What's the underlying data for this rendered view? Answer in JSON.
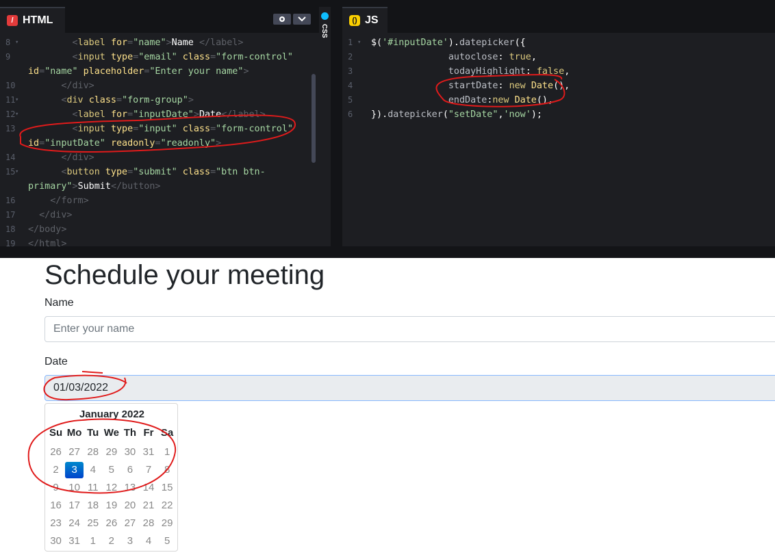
{
  "editor": {
    "html_tab": "HTML",
    "js_tab": "JS",
    "css_tab": "CSS",
    "html_lines": [
      {
        "n": "8",
        "arrow": true
      },
      {
        "n": "9",
        "arrow": false
      },
      {
        "n": "",
        "arrow": false
      },
      {
        "n": "10",
        "arrow": false
      },
      {
        "n": "11",
        "arrow": true
      },
      {
        "n": "12",
        "arrow": true
      },
      {
        "n": "13",
        "arrow": false
      },
      {
        "n": "",
        "arrow": false
      },
      {
        "n": "14",
        "arrow": false
      },
      {
        "n": "15",
        "arrow": true
      },
      {
        "n": "",
        "arrow": false
      },
      {
        "n": "16",
        "arrow": false
      },
      {
        "n": "17",
        "arrow": false
      },
      {
        "n": "18",
        "arrow": false
      },
      {
        "n": "19",
        "arrow": false
      }
    ],
    "js_lines": [
      "1",
      "2",
      "3",
      "4",
      "5",
      "6"
    ]
  },
  "page": {
    "heading": "Schedule your meeting",
    "name_label": "Name",
    "name_placeholder": "Enter your name",
    "date_label": "Date",
    "date_value": "01/03/2022"
  },
  "datepicker": {
    "title": "January 2022",
    "days": [
      "Su",
      "Mo",
      "Tu",
      "We",
      "Th",
      "Fr",
      "Sa"
    ],
    "weeks": [
      [
        [
          "26",
          1
        ],
        [
          "27",
          1
        ],
        [
          "28",
          1
        ],
        [
          "29",
          1
        ],
        [
          "30",
          1
        ],
        [
          "31",
          1
        ],
        [
          "1",
          1
        ]
      ],
      [
        [
          "2",
          1
        ],
        [
          "3",
          2
        ],
        [
          "4",
          1
        ],
        [
          "5",
          1
        ],
        [
          "6",
          1
        ],
        [
          "7",
          1
        ],
        [
          "8",
          1
        ]
      ],
      [
        [
          "9",
          1
        ],
        [
          "10",
          1
        ],
        [
          "11",
          1
        ],
        [
          "12",
          1
        ],
        [
          "13",
          1
        ],
        [
          "14",
          1
        ],
        [
          "15",
          1
        ]
      ],
      [
        [
          "16",
          1
        ],
        [
          "17",
          1
        ],
        [
          "18",
          1
        ],
        [
          "19",
          1
        ],
        [
          "20",
          1
        ],
        [
          "21",
          1
        ],
        [
          "22",
          1
        ]
      ],
      [
        [
          "23",
          1
        ],
        [
          "24",
          1
        ],
        [
          "25",
          1
        ],
        [
          "26",
          1
        ],
        [
          "27",
          1
        ],
        [
          "28",
          1
        ],
        [
          "29",
          1
        ]
      ],
      [
        [
          "30",
          1
        ],
        [
          "31",
          1
        ],
        [
          "1",
          1
        ],
        [
          "2",
          1
        ],
        [
          "3",
          1
        ],
        [
          "4",
          1
        ],
        [
          "5",
          1
        ]
      ]
    ]
  }
}
